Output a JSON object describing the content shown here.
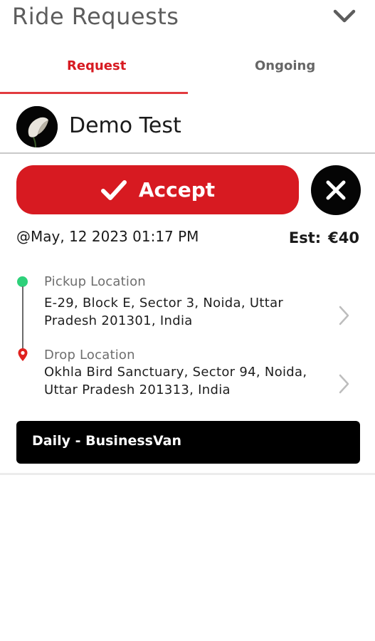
{
  "header": {
    "title": "Ride Requests",
    "collapse_icon": "chevron-down-icon"
  },
  "tabs": [
    {
      "label": "Request",
      "active": true
    },
    {
      "label": "Ongoing",
      "active": false
    }
  ],
  "colors": {
    "accent": "#d71a21",
    "pickup": "#2ed17a",
    "drop": "#e0221f",
    "dark": "#050505"
  },
  "request": {
    "rider_name": "Demo Test",
    "accept_label": "Accept",
    "accept_icon": "check-icon",
    "reject_icon": "close-icon",
    "datetime": "@May, 12 2023 01:17 PM",
    "est_label": "Est:",
    "est_value": "€40",
    "pickup": {
      "label": "Pickup Location",
      "address": "E-29, Block E, Sector 3, Noida, Uttar Pradesh 201301, India"
    },
    "drop": {
      "label": "Drop Location",
      "address": "Okhla Bird Sanctuary, Sector 94, Noida, Uttar Pradesh 201313, India"
    },
    "vehicle": "Daily - BusinessVan"
  }
}
